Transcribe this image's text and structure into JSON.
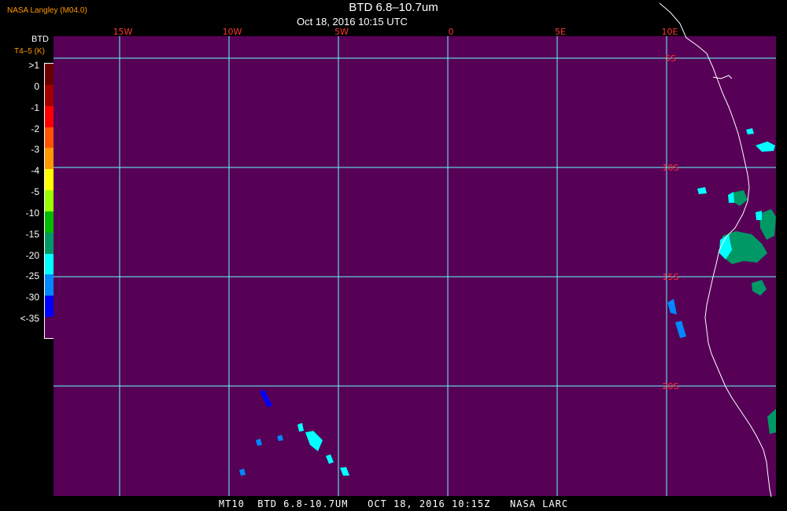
{
  "header": {
    "agency": "NASA Langley (M04.0)",
    "title": "BTD 6.8–10.7um",
    "timestamp": "Oct 18, 2016 10:15 UTC"
  },
  "legend": {
    "title": "BTD",
    "subtitle": "T4–5 (K)",
    "bins": [
      {
        "label": ">1",
        "color": "#6b0000"
      },
      {
        "label": "0",
        "color": "#a00000"
      },
      {
        "label": "-1",
        "color": "#ff0000"
      },
      {
        "label": "-2",
        "color": "#ff5500"
      },
      {
        "label": "-3",
        "color": "#ff9900"
      },
      {
        "label": "-4",
        "color": "#ffff00"
      },
      {
        "label": "-5",
        "color": "#99ff00"
      },
      {
        "label": "-10",
        "color": "#00bb00"
      },
      {
        "label": "-15",
        "color": "#009966"
      },
      {
        "label": "-20",
        "color": "#00ffff"
      },
      {
        "label": "-25",
        "color": "#0088ff"
      },
      {
        "label": "-30",
        "color": "#0000ff"
      },
      {
        "label": "<-35",
        "color": "#560056"
      }
    ]
  },
  "map": {
    "background_color": "#560056",
    "grid_color": "#66ffff",
    "label_color": "#ff3333",
    "coast_color": "#ffffff",
    "lon_labels": [
      "15W",
      "10W",
      "5W",
      "0",
      "5E",
      "10E"
    ],
    "lat_labels": [
      "5S",
      "10S",
      "15S",
      "20S"
    ]
  },
  "footer": {
    "text": "MT10  BTD 6.8-10.7UM   OCT 18, 2016 10:15Z   NASA LARC"
  }
}
